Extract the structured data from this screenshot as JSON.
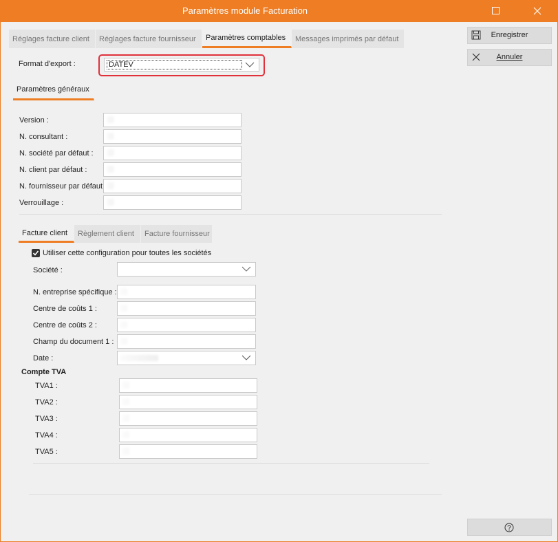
{
  "window": {
    "title": "Paramètres module Facturation"
  },
  "tabs": [
    "Réglages facture client",
    "Réglages facture fournisseur",
    "Paramètres comptables",
    "Messages imprimés par défaut"
  ],
  "active_tab": "Paramètres comptables",
  "export": {
    "label": "Format d'export :",
    "value": "DATEV"
  },
  "general_tab": "Paramètres généraux",
  "general": {
    "version": "Version :",
    "consultant": "N. consultant :",
    "societe": "N. société par défaut :",
    "client": "N. client par défaut :",
    "fournisseur": "N. fournisseur par défaut :",
    "verrouillage": "Verrouillage :"
  },
  "sub_tabs": [
    "Facture client",
    "Règlement client",
    "Facture fournisseur"
  ],
  "checkbox": {
    "label": "Utiliser cette configuration pour toutes les sociétés",
    "checked": true
  },
  "client_fields": {
    "societe": "Société :",
    "entreprise": "N. entreprise spécifique :",
    "cc1": "Centre de coûts 1 :",
    "cc2": "Centre de coûts 2 :",
    "champ": "Champ du document 1 :",
    "date": "Date :"
  },
  "tva": {
    "heading": "Compte TVA",
    "labels": [
      "TVA1 :",
      "TVA2 :",
      "TVA3 :",
      "TVA4 :",
      "TVA5 :"
    ]
  },
  "buttons": {
    "save": "Enregistrer",
    "cancel": "Annuler",
    "help_icon": "help-icon"
  },
  "colors": {
    "accent": "#ee7d23",
    "highlight": "#e0303a",
    "background": "#f0f0f0"
  }
}
